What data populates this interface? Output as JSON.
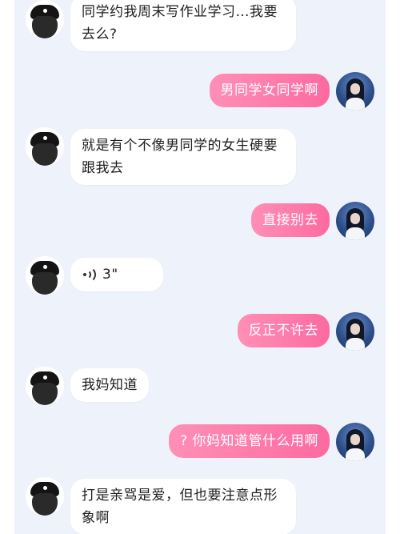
{
  "messages": [
    {
      "side": "left",
      "text": "同学约我周末写作业学习…我要去么?"
    },
    {
      "side": "right",
      "text": "男同学女同学啊"
    },
    {
      "side": "left",
      "text": "就是有个不像男同学的女生硬要跟我去"
    },
    {
      "side": "right",
      "text": "直接别去"
    },
    {
      "side": "left",
      "type": "voice",
      "text": "3\"",
      "icon": "voice-wave-icon"
    },
    {
      "side": "right",
      "text": "反正不许去"
    },
    {
      "side": "left",
      "text": "我妈知道"
    },
    {
      "side": "right",
      "text": "? 你妈知道管什么用啊"
    },
    {
      "side": "left",
      "text": "打是亲骂是爱，但也要注意点形象啊"
    }
  ],
  "colors": {
    "background": "#eef3fb",
    "bubble_left": "#ffffff",
    "bubble_right_start": "#ff8fb6",
    "bubble_right_end": "#fd6aa0"
  }
}
